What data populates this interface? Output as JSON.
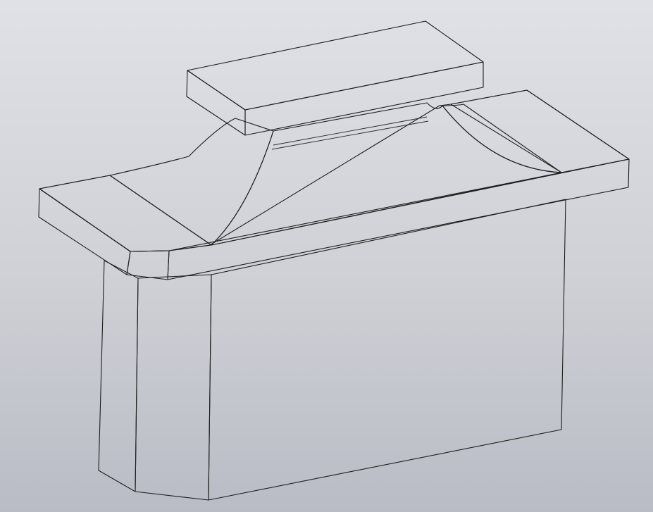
{
  "viewport": {
    "background_top": "#e0e1e6",
    "background_bottom": "#b9bcc5"
  },
  "model": {
    "shading": {
      "front_face": "#8e8e8e",
      "side_face_dark": "#5a5a5a",
      "side_face_mid": "#7a7a7a",
      "top_face": "#959595",
      "flange_front": "#9a9a9a",
      "flange_side": "#676767",
      "fillet_light": "#b0b0b0",
      "fillet_shadow": "#7c7c7c",
      "top_plate_top": "#939393",
      "top_plate_front": "#8d8d8d",
      "top_plate_side": "#5f5f5f",
      "edge_color": "#1d1d1d"
    }
  }
}
